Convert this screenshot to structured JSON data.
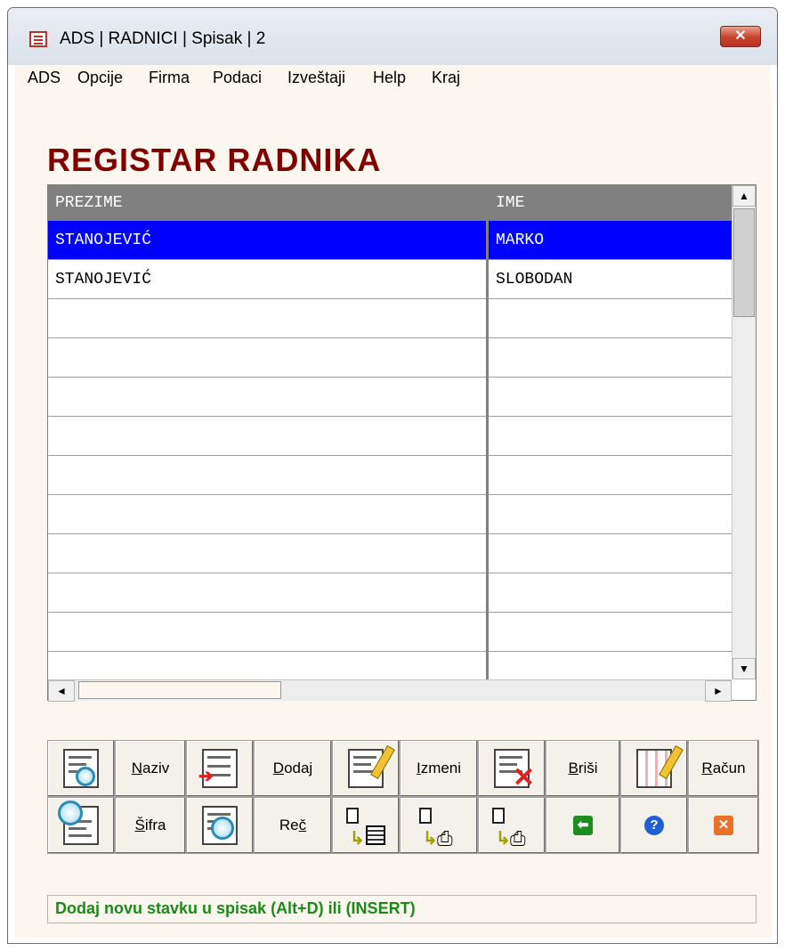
{
  "window": {
    "title": "ADS | RADNICI | Spisak | 2",
    "close_label": "✕"
  },
  "menu": [
    "ADS",
    "Opcije",
    "Firma",
    "Podaci",
    "Izveštaji",
    "Help",
    "Kraj"
  ],
  "heading": "REGISTAR RADNIKA",
  "grid": {
    "columns": [
      "PREZIME",
      "IME"
    ],
    "rows": [
      {
        "prezime": "STANOJEVIĆ",
        "ime": "MARKO",
        "selected": true
      },
      {
        "prezime": "STANOJEVIĆ",
        "ime": "SLOBODAN",
        "selected": false
      }
    ],
    "scroll": {
      "up": "▲",
      "down": "▼",
      "left": "◄",
      "right": "►"
    }
  },
  "toolbar": {
    "row1": [
      {
        "icon": "search-name-icon"
      },
      {
        "label": "Naziv",
        "accel": "N"
      },
      {
        "icon": "add-record-icon"
      },
      {
        "label": "Dodaj",
        "accel": "D"
      },
      {
        "icon": "edit-record-icon"
      },
      {
        "label": "Izmeni",
        "accel": "I"
      },
      {
        "icon": "delete-record-icon"
      },
      {
        "label": "Briši",
        "accel": "B"
      },
      {
        "icon": "calculate-icon"
      },
      {
        "label": "Račun",
        "accel": "R"
      }
    ],
    "row2": [
      {
        "icon": "search-code-icon"
      },
      {
        "label": "Šifra",
        "accel": "Š"
      },
      {
        "icon": "search-word-icon"
      },
      {
        "label": "Reč",
        "accel": "č"
      },
      {
        "icon": "export-list-icon"
      },
      {
        "icon": "print-icon"
      },
      {
        "icon": "print-preview-icon"
      },
      {
        "icon": "back-arrow-icon",
        "glyph": "⬅",
        "color": "#1e8c1e"
      },
      {
        "icon": "help-icon",
        "glyph": "?",
        "color": "#1f5fd1"
      },
      {
        "icon": "exit-icon",
        "glyph": "✕",
        "color": "#e8702a"
      }
    ]
  },
  "status": "Dodaj novu stavku u spisak (Alt+D) ili (INSERT)"
}
